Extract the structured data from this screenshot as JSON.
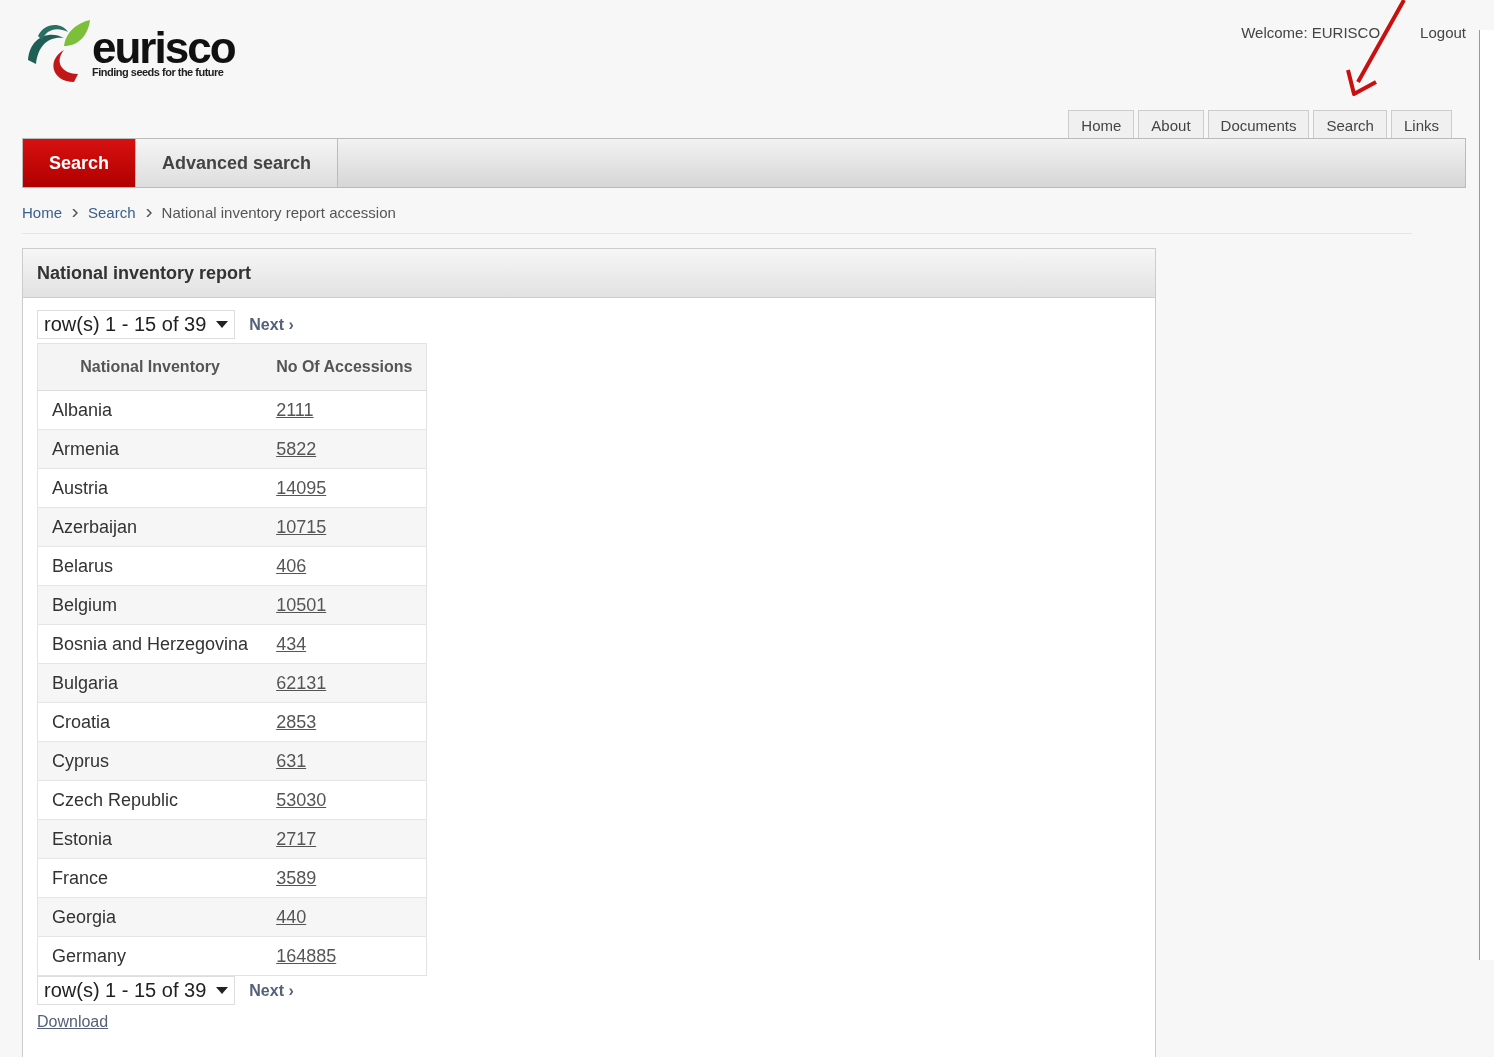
{
  "header": {
    "logo": {
      "name": "eurisco",
      "tagline": "Finding seeds for the future"
    },
    "welcome": "Welcome: EURISCO",
    "logout": "Logout"
  },
  "top_nav": [
    {
      "label": "Home"
    },
    {
      "label": "About"
    },
    {
      "label": "Documents"
    },
    {
      "label": "Search"
    },
    {
      "label": "Links"
    }
  ],
  "tabs": [
    {
      "label": "Search",
      "selected": true
    },
    {
      "label": "Advanced search",
      "selected": false
    }
  ],
  "breadcrumb": [
    {
      "label": "Home",
      "kind": "link"
    },
    {
      "label": "Search",
      "kind": "link"
    },
    {
      "label": "National inventory report accession",
      "kind": "current"
    }
  ],
  "panel": {
    "title": "National inventory report",
    "pager_top": {
      "range": "row(s) 1 - 15 of 39",
      "next": "Next ›"
    },
    "table": {
      "columns": [
        "National Inventory",
        "No Of Accessions"
      ],
      "rows": [
        [
          "Albania",
          "2111"
        ],
        [
          "Armenia",
          "5822"
        ],
        [
          "Austria",
          "14095"
        ],
        [
          "Azerbaijan",
          "10715"
        ],
        [
          "Belarus",
          "406"
        ],
        [
          "Belgium",
          "10501"
        ],
        [
          "Bosnia and Herzegovina",
          "434"
        ],
        [
          "Bulgaria",
          "62131"
        ],
        [
          "Croatia",
          "2853"
        ],
        [
          "Cyprus",
          "631"
        ],
        [
          "Czech Republic",
          "53030"
        ],
        [
          "Estonia",
          "2717"
        ],
        [
          "France",
          "3589"
        ],
        [
          "Georgia",
          "440"
        ],
        [
          "Germany",
          "164885"
        ]
      ]
    },
    "pager_bottom": {
      "range": "row(s) 1 - 15 of 39",
      "next": "Next ›"
    },
    "download": "Download"
  }
}
